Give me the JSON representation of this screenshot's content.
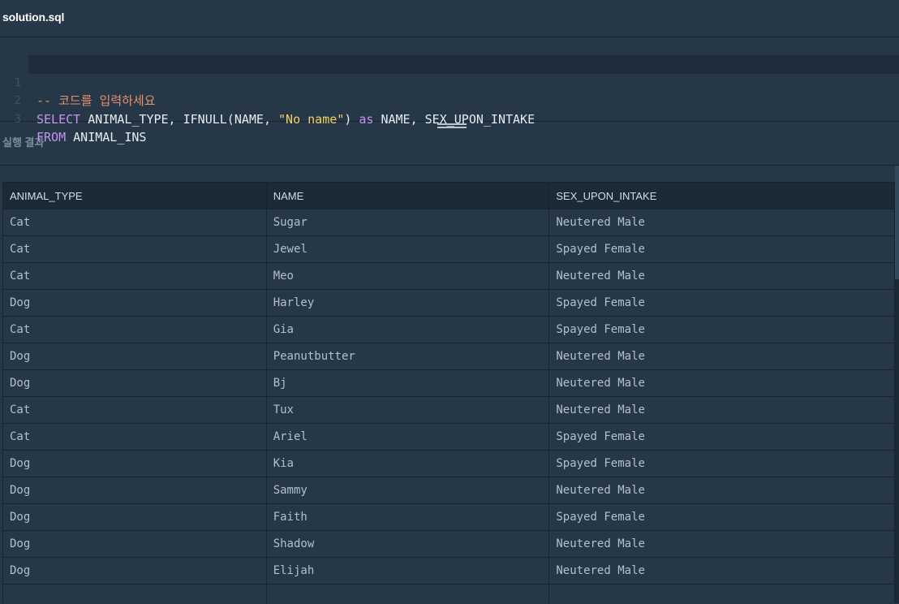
{
  "editor": {
    "file_name": "solution.sql",
    "lines": [
      {
        "number": "1",
        "comment": "-- 코드를 입력하세요"
      },
      {
        "number": "2",
        "kw1": "SELECT",
        "p1": " ANIMAL_TYPE, IFNULL(NAME, ",
        "str": "\"No name\"",
        "p2": ") ",
        "kw2": "as",
        "p3": " NAME, SEX_UPON_INTAKE"
      },
      {
        "number": "3",
        "kw1": "FROM",
        "p1": " ANIMAL_INS"
      }
    ]
  },
  "result": {
    "title": "실행 결과",
    "columns": [
      "ANIMAL_TYPE",
      "NAME",
      "SEX_UPON_INTAKE"
    ],
    "rows": [
      [
        "Cat",
        "Sugar",
        "Neutered Male"
      ],
      [
        "Cat",
        "Jewel",
        "Spayed Female"
      ],
      [
        "Cat",
        "Meo",
        "Neutered Male"
      ],
      [
        "Dog",
        "Harley",
        "Spayed Female"
      ],
      [
        "Cat",
        "Gia",
        "Spayed Female"
      ],
      [
        "Dog",
        "Peanutbutter",
        "Neutered Male"
      ],
      [
        "Dog",
        "Bj",
        "Neutered Male"
      ],
      [
        "Cat",
        "Tux",
        "Neutered Male"
      ],
      [
        "Cat",
        "Ariel",
        "Spayed Female"
      ],
      [
        "Dog",
        "Kia",
        "Spayed Female"
      ],
      [
        "Dog",
        "Sammy",
        "Neutered Male"
      ],
      [
        "Dog",
        "Faith",
        "Spayed Female"
      ],
      [
        "Dog",
        "Shadow",
        "Neutered Male"
      ],
      [
        "Dog",
        "Elijah",
        "Neutered Male"
      ],
      [
        "",
        "",
        ""
      ]
    ]
  }
}
